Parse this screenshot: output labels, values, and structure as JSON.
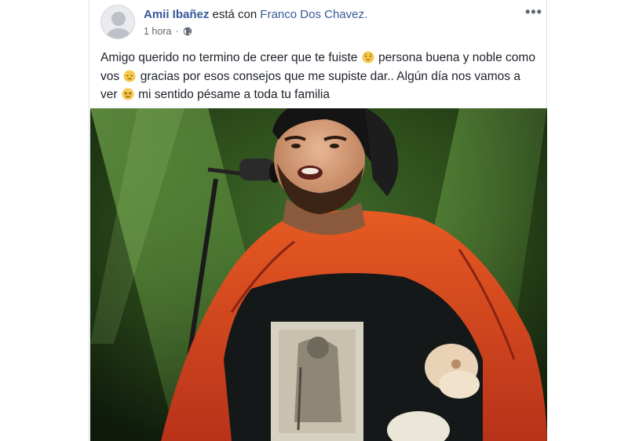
{
  "post": {
    "author": "Amii Ibañez",
    "with_text": "está con",
    "tagged": "Franco Dos Chavez.",
    "time": "1 hora",
    "separator": "·",
    "more_label": "•••",
    "text_parts": [
      "Amigo querido no termino de creer que te fuiste ",
      " persona buena y noble como vos ",
      " gracias por esos consejos que me supiste dar.. Algún día nos vamos a ver ",
      " mi sentido pésame a toda tu familia"
    ],
    "emojis": [
      "relieved-face",
      "disappointed-face",
      "persevering-face"
    ],
    "icons": {
      "privacy": "globe-icon",
      "options": "more-options-icon"
    },
    "photo_icon": "shared-photo"
  },
  "colors": {
    "link": "#365899",
    "text": "#1d2129",
    "meta": "#616770",
    "emoji": "#f7c84b"
  }
}
